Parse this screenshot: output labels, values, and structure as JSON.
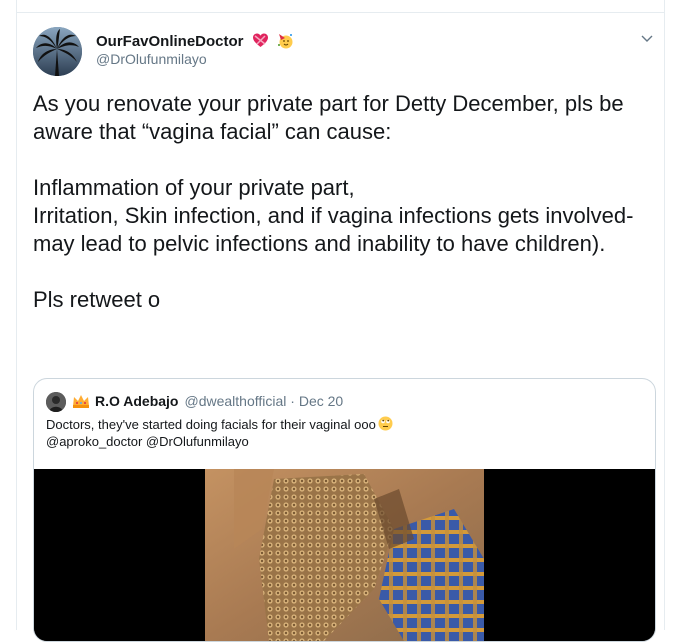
{
  "tweet": {
    "display_name": "OurFavOnlineDoctor",
    "handle": "@DrOlufunmilayo",
    "text": "As you renovate your private part for Detty December, pls be aware that “vagina facial” can cause:\n\nInflammation of your private part,\nIrritation, Skin infection, and if vagina infections gets involved- may lead to pelvic infections and inability to have children).\n\nPls retweet o",
    "name_emojis": [
      "heart-with-ribbon-emoji",
      "partying-face-emoji"
    ]
  },
  "quote": {
    "display_name": "R.O Adebajo",
    "handle": "@dwealthofficial",
    "date": "· Dec 20",
    "text_line1": "Doctors, they've started doing facials for their vaginal ooo",
    "text_line2": "@aproko_doctor @DrOlufunmilayo",
    "emoji": "rolling-eyes-emoji",
    "media": "video-thumbnail"
  },
  "colors": {
    "text": "#14171a",
    "secondary": "#657786",
    "border": "#ccd6dd",
    "divider": "#e6ecf0"
  },
  "icons": [
    "chevron-down-icon"
  ]
}
